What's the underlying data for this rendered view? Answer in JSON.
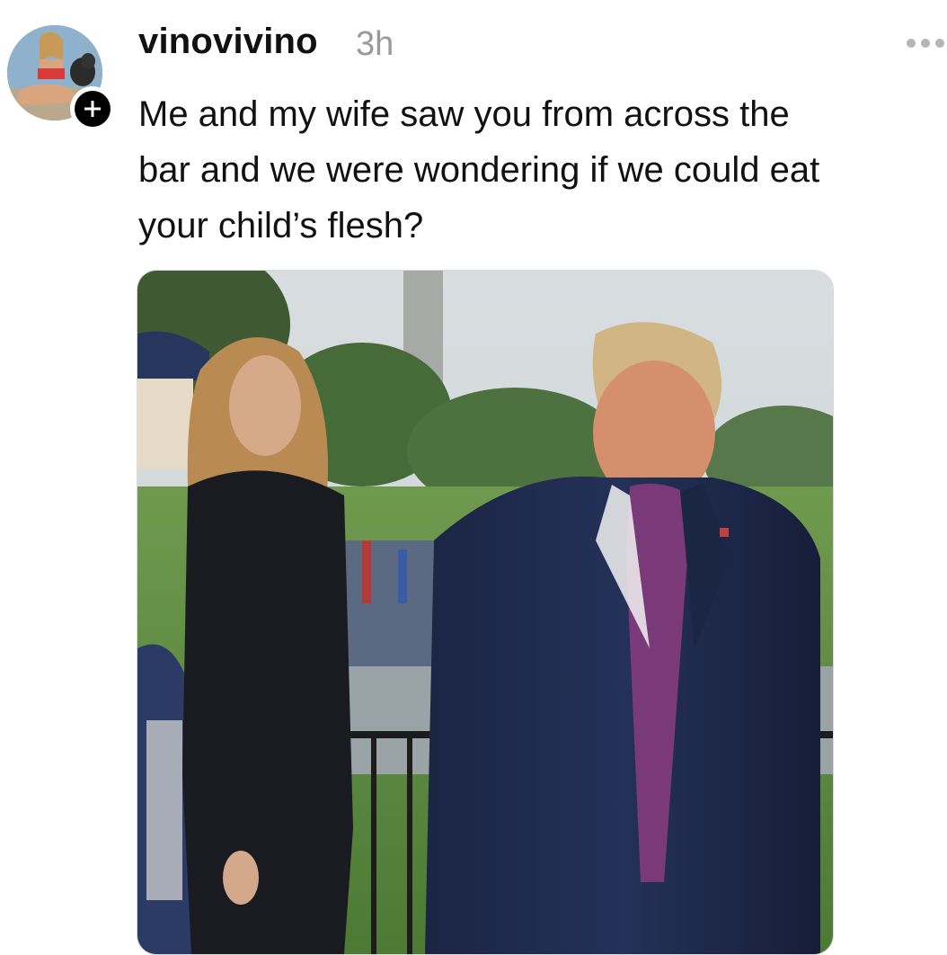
{
  "post": {
    "username": "vinovivino",
    "timestamp": "3h",
    "text": "Me and my wife saw you from across the\nbar and we were wondering if we could eat\nyour child’s flesh?"
  },
  "icons": {
    "follow": "plus-icon",
    "more": "more-horizontal-icon"
  },
  "colors": {
    "text": "#111111",
    "muted": "#9a9a9a",
    "badge": "#000000"
  }
}
